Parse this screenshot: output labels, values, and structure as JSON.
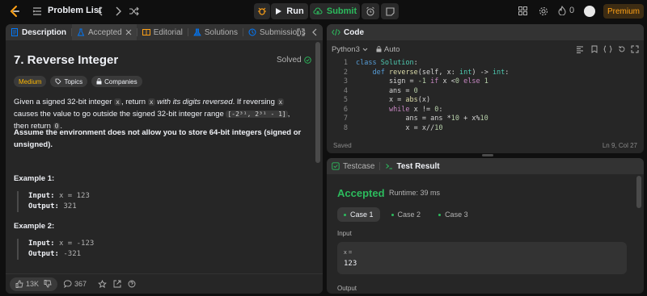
{
  "nav": {
    "title": "Problem List",
    "run_label": "Run",
    "submit_label": "Submit",
    "streak_count": "0",
    "premium_label": "Premium"
  },
  "left_tabs": [
    {
      "label": "Description"
    },
    {
      "label": "Accepted"
    },
    {
      "label": "Editorial"
    },
    {
      "label": "Solutions"
    },
    {
      "label": "Submissions"
    }
  ],
  "problem": {
    "title": "7. Reverse Integer",
    "status": "Solved",
    "difficulty": "Medium",
    "topics_label": "Topics",
    "companies_label": "Companies",
    "desc_p1": "Given a signed 32-bit integer ",
    "desc_x": "x",
    "desc_p2": ", return ",
    "desc_p3": " with its digits reversed",
    "desc_p4": ". If reversing ",
    "desc_p5": " causes the value to go outside the signed 32-bit integer range ",
    "desc_range": "[-2³¹, 2³¹ - 1]",
    "desc_p6": ", then return ",
    "desc_zero": "0",
    "desc_p7": ".",
    "assumption": "Assume the environment does not allow you to store 64-bit integers (signed or unsigned).",
    "examples": [
      {
        "title": "Example 1:",
        "input": "x = 123",
        "output": "321"
      },
      {
        "title": "Example 2:",
        "input": "x = -123",
        "output": "-321"
      }
    ],
    "input_label": "Input:",
    "output_label": "Output:"
  },
  "footer": {
    "likes": "13K",
    "comments": "367"
  },
  "code": {
    "title": "Code",
    "language": "Python3",
    "auto_label": "Auto",
    "saved": "Saved",
    "cursor": "Ln 9, Col 27"
  },
  "result": {
    "testcase_tab": "Testcase",
    "result_tab": "Test Result",
    "status": "Accepted",
    "runtime": "Runtime: 39 ms",
    "cases": [
      "Case 1",
      "Case 2",
      "Case 3"
    ],
    "input_label": "Input",
    "var_name": "x =",
    "var_value": "123",
    "output_label": "Output"
  }
}
